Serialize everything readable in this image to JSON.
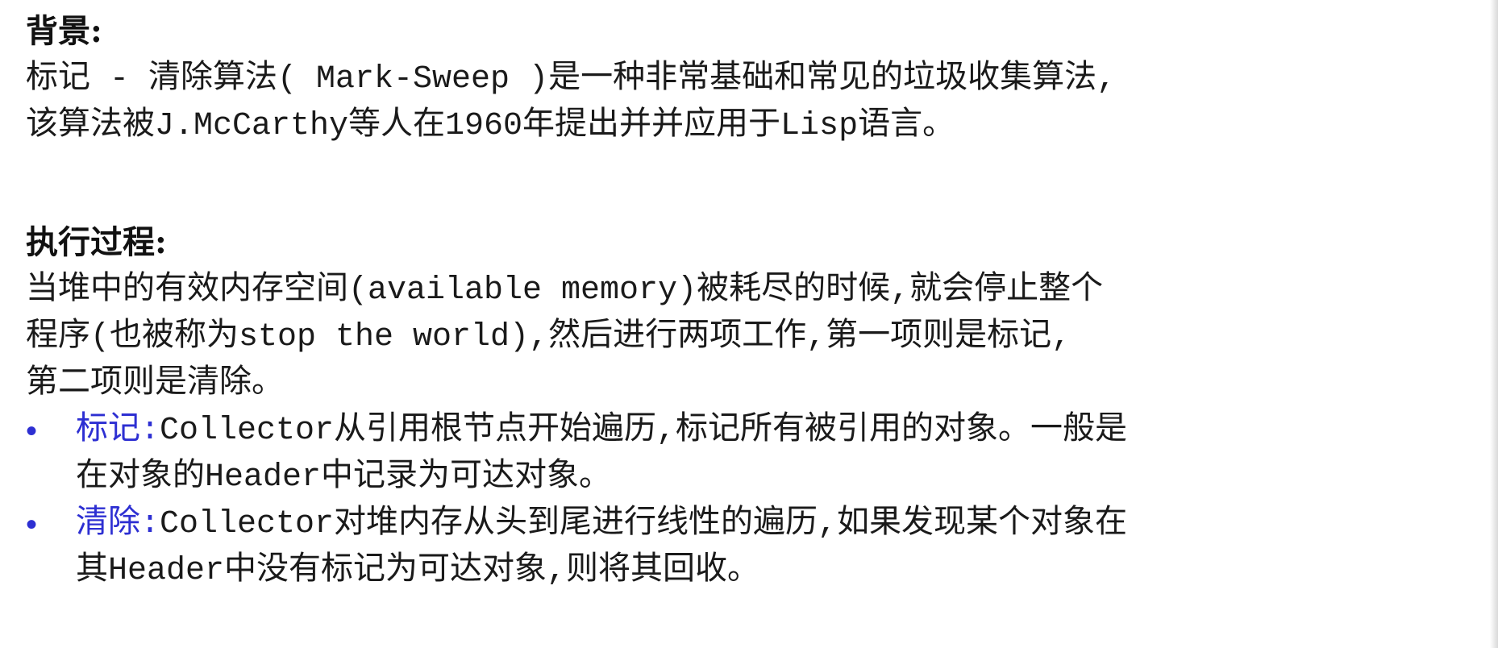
{
  "background": {
    "heading": "背景:",
    "lines": [
      "标记 - 清除算法( Mark-Sweep )是一种非常基础和常见的垃圾收集算法,",
      "该算法被J.McCarthy等人在1960年提出并并应用于Lisp语言。"
    ]
  },
  "process": {
    "heading": "执行过程:",
    "lines": [
      "当堆中的有效内存空间(available memory)被耗尽的时候,就会停止整个",
      "程序(也被称为stop the world),然后进行两项工作,第一项则是标记,",
      "第二项则是清除。"
    ],
    "bullets": [
      {
        "term": "标记:",
        "text": "Collector从引用根节点开始遍历,标记所有被引用的对象。一般是",
        "continuation": "在对象的Header中记录为可达对象。"
      },
      {
        "term": "清除:",
        "text": "Collector对堆内存从头到尾进行线性的遍历,如果发现某个对象在",
        "continuation": "其Header中没有标记为可达对象,则将其回收。"
      }
    ],
    "bullet_glyph": "•"
  },
  "colors": {
    "accent": "#2d2fd2",
    "text": "#1a1a1a"
  }
}
